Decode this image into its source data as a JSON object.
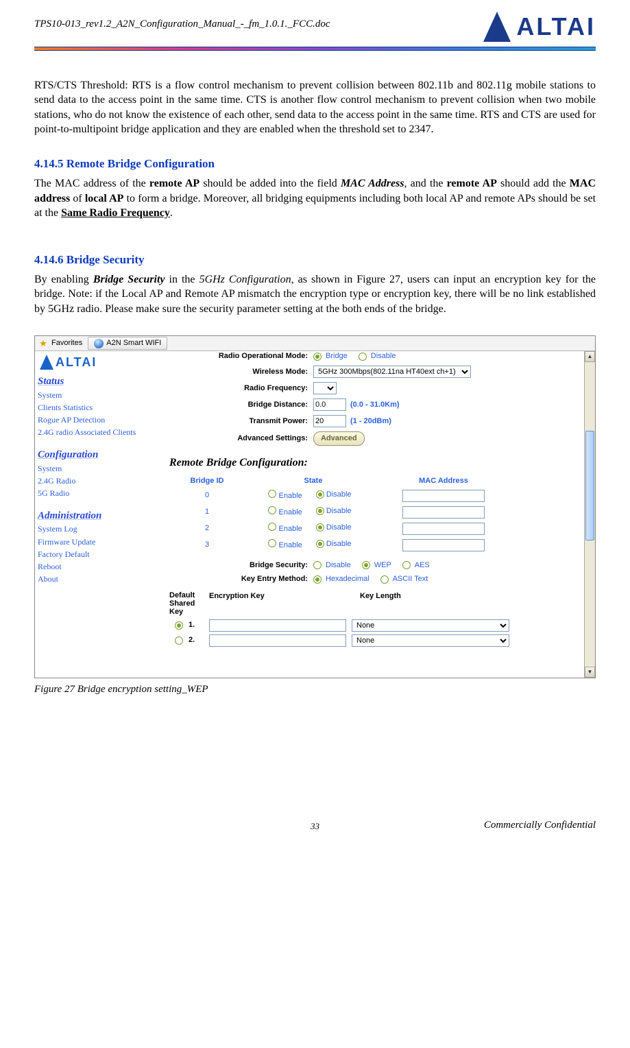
{
  "header": {
    "doc_name": "TPS10-013_rev1.2_A2N_Configuration_Manual_-_fm_1.0.1._FCC.doc",
    "logo_text": "ALTAI"
  },
  "paragraphs": {
    "rts": "RTS/CTS Threshold: RTS is a flow control mechanism to prevent collision between 802.11b and 802.11g mobile stations to send data to the access point in the same time. CTS is another flow control mechanism to prevent collision when two mobile stations, who do not know the existence of each other, send data to the access point in the same time. RTS and CTS are used for point-to-multipoint bridge application and they are enabled when the threshold set to 2347.",
    "h4145": "4.14.5  Remote Bridge Configuration",
    "p4145_a": "The MAC address of the ",
    "p4145_b": "remote AP",
    "p4145_c": " should be added into the field ",
    "p4145_d": "MAC Address",
    "p4145_e": ", and the ",
    "p4145_f": "remote AP",
    "p4145_g": " should add the ",
    "p4145_h": "MAC address",
    "p4145_i": " of ",
    "p4145_j": "local AP",
    "p4145_k": " to form a bridge.    Moreover, all bridging equipments including both local AP and remote APs should be set at the ",
    "p4145_l": "Same Radio Frequency",
    "p4145_m": ".",
    "h4146": "4.14.6  Bridge Security",
    "p4146_a": "By enabling ",
    "p4146_b": "Bridge Security",
    "p4146_c": " in the ",
    "p4146_d": "5GHz Configuration",
    "p4146_e": ", as shown in Figure 27, users can input an encryption key for the bridge. Note: if the Local AP and Remote AP mismatch the encryption type or encryption key, there will be no link established by 5GHz radio. Please make sure the security parameter setting at the both ends of the bridge."
  },
  "screenshot": {
    "favorites_label": "Favorites",
    "tab_title": "A2N Smart WIFI",
    "sidebar_logo": "ALTAI",
    "nav": {
      "status": "Status",
      "status_items": [
        "System",
        "Clients Statistics",
        "Rogue AP Detection",
        "2.4G radio Associated Clients"
      ],
      "config": "Configuration",
      "config_items": [
        "System",
        "2.4G Radio",
        "5G Radio"
      ],
      "admin": "Administration",
      "admin_items": [
        "System Log",
        "Firmware Update",
        "Factory Default",
        "Reboot",
        "About"
      ]
    },
    "cutoff_label": "Radio Operational Mode:",
    "labels": {
      "wireless_mode": "Wireless Mode:",
      "radio_freq": "Radio Frequency:",
      "bridge_distance": "Bridge Distance:",
      "transmit_power": "Transmit Power:",
      "advanced": "Advanced Settings:",
      "bridge_security": "Bridge Security:",
      "key_entry": "Key Entry Method:"
    },
    "radio": {
      "bridge": "Bridge",
      "disable": "Disable",
      "enable": "Enable",
      "wep": "WEP",
      "aes": "AES",
      "hex": "Hexadecimal",
      "ascii": "ASCII Text"
    },
    "wireless_mode_value": "5GHz 300Mbps(802.11na HT40ext ch+1)",
    "bridge_distance_value": "0.0",
    "bridge_distance_hint": "(0.0 - 31.0Km)",
    "transmit_power_value": "20",
    "transmit_power_hint": "(1 - 20dBm)",
    "advanced_btn": "Advanced",
    "rbc_title": "Remote Bridge Configuration:",
    "tbl": {
      "bridge_id": "Bridge ID",
      "state": "State",
      "mac": "MAC Address"
    },
    "bridge_ids": [
      "0",
      "1",
      "2",
      "3"
    ],
    "key_header": {
      "dsk": "Default Shared Key",
      "enc": "Encryption Key",
      "len": "Key Length"
    },
    "key_rows": [
      {
        "num": "1.",
        "len": "None"
      },
      {
        "num": "2.",
        "len": "None"
      }
    ]
  },
  "caption": "Figure 27      Bridge encryption setting_WEP",
  "footer": {
    "page": "33",
    "conf": "Commercially Confidential"
  }
}
